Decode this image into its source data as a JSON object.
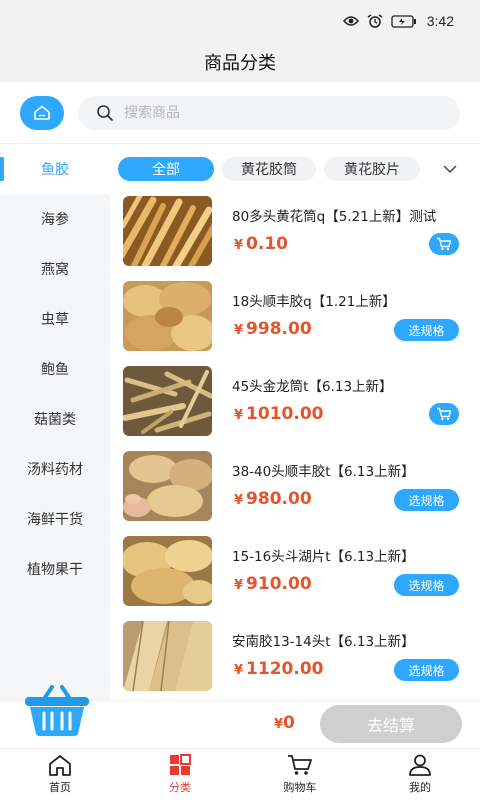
{
  "status_bar": {
    "time": "3:42"
  },
  "header": {
    "title": "商品分类"
  },
  "search": {
    "placeholder": "搜索商品"
  },
  "sidebar": {
    "items": [
      {
        "label": "鱼胶"
      },
      {
        "label": "海参"
      },
      {
        "label": "燕窝"
      },
      {
        "label": "虫草"
      },
      {
        "label": "鲍鱼"
      },
      {
        "label": "菇菌类"
      },
      {
        "label": "汤料药材"
      },
      {
        "label": "海鲜干货"
      },
      {
        "label": "植物果干"
      }
    ]
  },
  "subtabs": [
    {
      "label": "全部"
    },
    {
      "label": "黄花胶筒"
    },
    {
      "label": "黄花胶片"
    }
  ],
  "products": [
    {
      "name": "80多头黄花筒q【5.21上新】测试",
      "currency": "¥",
      "price": "0.10",
      "action": "cart"
    },
    {
      "name": "18头顺丰胶q【1.21上新】",
      "currency": "¥",
      "price": "998.00",
      "action": "选规格"
    },
    {
      "name": "45头金龙筒t【6.13上新】",
      "currency": "¥",
      "price": "1010.00",
      "action": "cart"
    },
    {
      "name": "38-40头顺丰胶t【6.13上新】",
      "currency": "¥",
      "price": "980.00",
      "action": "选规格"
    },
    {
      "name": "15-16头斗湖片t【6.13上新】",
      "currency": "¥",
      "price": "910.00",
      "action": "选规格"
    },
    {
      "name": "安南胶13-14头t【6.13上新】",
      "currency": "¥",
      "price": "1120.00",
      "action": "选规格"
    }
  ],
  "checkout": {
    "currency": "¥",
    "total": "0",
    "button_label": "去结算"
  },
  "tabbar": [
    {
      "label": "首页",
      "icon": "home-icon"
    },
    {
      "label": "分类",
      "icon": "category-icon"
    },
    {
      "label": "购物车",
      "icon": "cart-icon"
    },
    {
      "label": "我的",
      "icon": "user-icon"
    }
  ],
  "colors": {
    "accent": "#2ea7ff",
    "price": "#e4542d",
    "active_tab": "#e83a2f",
    "pay_disabled": "#cfcfcf"
  }
}
